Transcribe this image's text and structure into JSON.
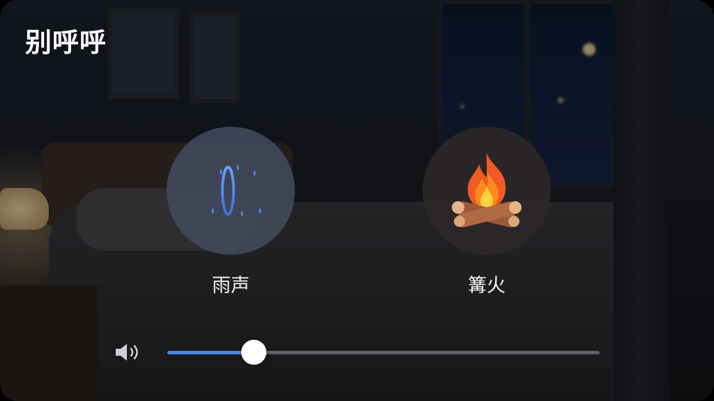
{
  "app": {
    "title": "别呼呼"
  },
  "sounds": [
    {
      "label": "雨声",
      "icon": "rain-sound-wave-icon",
      "accent": "#4e86e4"
    },
    {
      "label": "篝火",
      "icon": "campfire-icon",
      "accent": "#f0722a"
    }
  ],
  "volume": {
    "icon": "speaker-volume-icon",
    "level": 0.2,
    "fill_color": "#4e86e4"
  }
}
